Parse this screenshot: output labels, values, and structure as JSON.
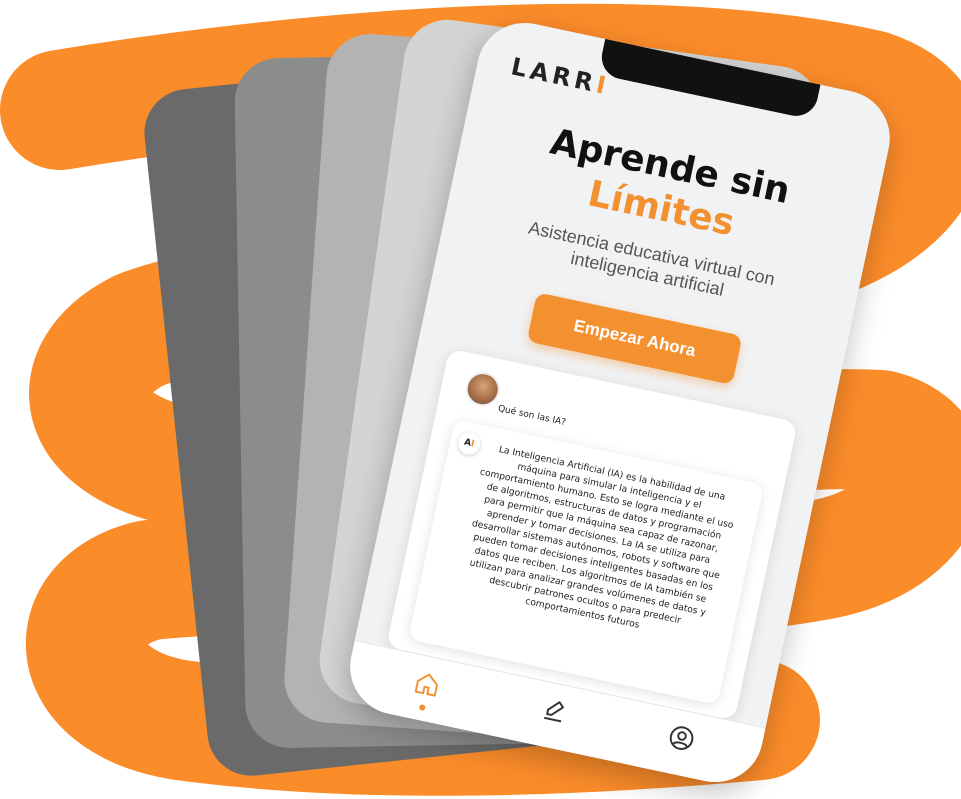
{
  "colors": {
    "accent": "#f39130",
    "scribble": "#fb8c2a",
    "card_dark": "#6a6a6a",
    "card_mid": "#8c8c8c",
    "card_light": "#b3b3b3",
    "card_lighter": "#d4d4d4"
  },
  "app": {
    "logo_main": "LARR",
    "logo_accent": "I"
  },
  "hero": {
    "title_line1": "Aprende sin",
    "title_line2": "Límites",
    "subtitle": "Asistencia educativa virtual con inteligencia artificial",
    "cta_label": "Empezar Ahora"
  },
  "chat": {
    "question": "Qué son las IA?",
    "bot_badge_main": "A",
    "bot_badge_accent": "I",
    "answer": "La Inteligencia Artificial (IA) es la habilidad de una máquina para simular la inteligencia y el comportamiento humano. Esto se logra mediante el uso de algoritmos, estructuras de datos y programación para permitir que la máquina sea capaz de razonar, aprender y tomar decisiones. La IA se utiliza para desarrollar sistemas autónomos, robots y software que pueden tomar decisiones inteligentes basadas en los datos que reciben. Los algoritmos de IA también se utilizan para analizar grandes volúmenes de datos y descubrir patrones ocultos o para predecir comportamientos futuros"
  },
  "nav": {
    "items": [
      {
        "icon": "home-icon",
        "active": true
      },
      {
        "icon": "edit-icon",
        "active": false
      },
      {
        "icon": "profile-icon",
        "active": false
      }
    ]
  }
}
